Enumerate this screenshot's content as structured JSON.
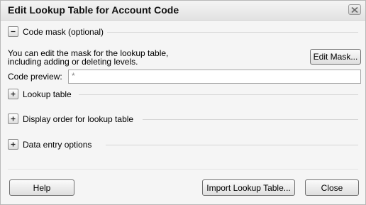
{
  "window": {
    "title": "Edit Lookup Table for Account Code"
  },
  "sections": {
    "code_mask": {
      "label": "Code mask (optional)",
      "toggle": "-"
    },
    "lookup_table": {
      "label": "Lookup table",
      "toggle": "+"
    },
    "display_order": {
      "label": "Display order for lookup table",
      "toggle": "+"
    },
    "data_entry": {
      "label": "Data entry options",
      "toggle": "+"
    }
  },
  "mask": {
    "description_line1": "You can edit the mask for the lookup table,",
    "description_line2": "including adding or deleting levels.",
    "edit_mask_button": "Edit Mask...",
    "preview_label": "Code preview:",
    "preview_value": "*"
  },
  "footer": {
    "help_button": "Help",
    "import_button": "Import Lookup Table...",
    "close_button": "Close"
  },
  "icons": {
    "collapse": "minus-icon",
    "expand": "plus-icon",
    "close": "close-icon"
  },
  "colors": {
    "dialog_bg": "#f5f5f5",
    "titlebar_bg": "#e6e6e6",
    "text": "#000000"
  }
}
